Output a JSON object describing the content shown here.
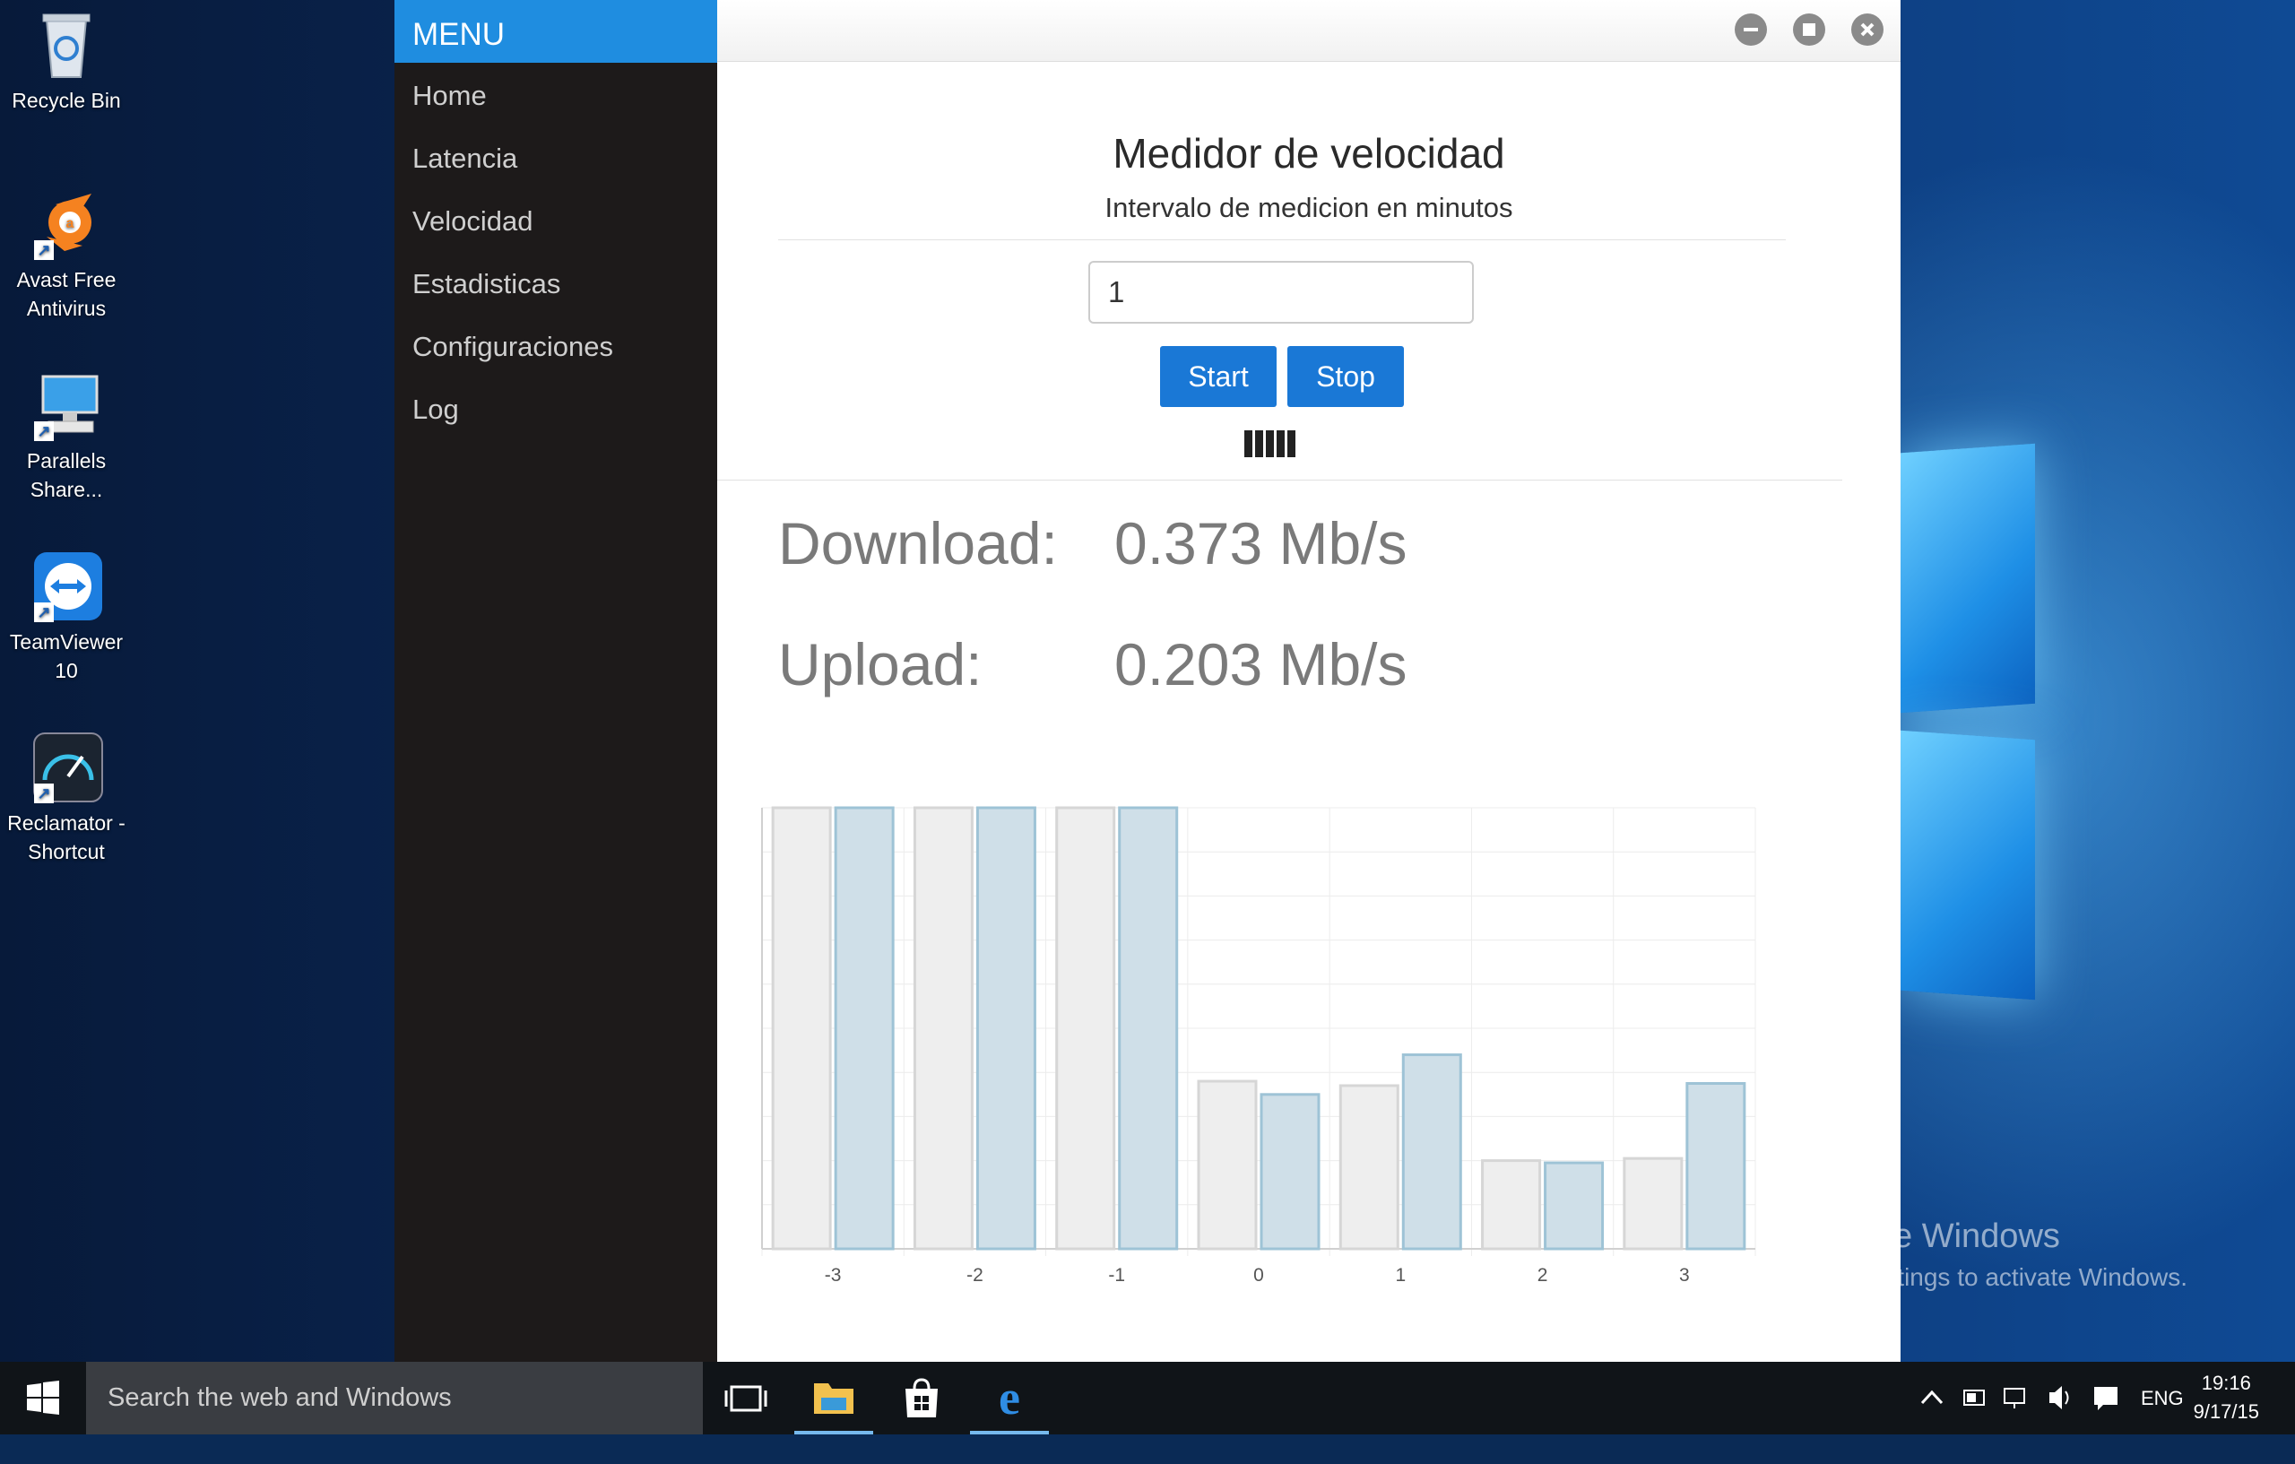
{
  "desktop": {
    "icons": [
      {
        "label": "Recycle Bin",
        "icon": "recycle-bin-icon"
      },
      {
        "label": "Avast Free Antivirus",
        "icon": "avast-icon"
      },
      {
        "label": "Parallels Share...",
        "icon": "parallels-icon"
      },
      {
        "label": "TeamViewer 10",
        "icon": "teamviewer-icon"
      },
      {
        "label": "Reclamator - Shortcut",
        "icon": "speedometer-icon"
      }
    ],
    "watermark": {
      "line1": "Activate Windows",
      "line2": "Go to Settings to activate Windows."
    }
  },
  "app": {
    "menu": {
      "title": "MENU",
      "items": [
        "Home",
        "Latencia",
        "Velocidad",
        "Estadisticas",
        "Configuraciones",
        "Log"
      ]
    },
    "window_controls": [
      "minimize-icon",
      "maximize-icon",
      "close-icon"
    ],
    "main": {
      "title": "Medidor de velocidad",
      "subtitle": "Intervalo de medicion en minutos",
      "interval_value": "1",
      "start_label": "Start",
      "stop_label": "Stop",
      "download_label": "Download:",
      "download_value": "0.373 Mb/s",
      "upload_label": "Upload:",
      "upload_value": "0.203 Mb/s"
    },
    "chart_data": {
      "type": "bar",
      "categories": [
        "-3",
        "-2",
        "-1",
        "0",
        "1",
        "2",
        "3"
      ],
      "series": [
        {
          "values": [
            10,
            10,
            10,
            3.8,
            3.7,
            2.0,
            2.05
          ],
          "color": "#eeeeee",
          "stroke": "#d6d6d6"
        },
        {
          "values": [
            10,
            10,
            10,
            3.5,
            4.4,
            1.95,
            3.75
          ],
          "color": "#cfdfe8",
          "stroke": "#9ec3d6"
        }
      ],
      "ylim": [
        0,
        10
      ],
      "grid": true,
      "legend": "none"
    }
  },
  "taskbar": {
    "search_placeholder": "Search the web and Windows",
    "language": "ENG",
    "time": "19:16",
    "date": "9/17/15",
    "pinned": [
      "task-view-icon",
      "file-explorer-icon",
      "store-icon",
      "edge-icon"
    ],
    "tray_icons": [
      "chevron-up-icon",
      "power-icon",
      "network-icon",
      "volume-icon",
      "notifications-icon"
    ]
  }
}
